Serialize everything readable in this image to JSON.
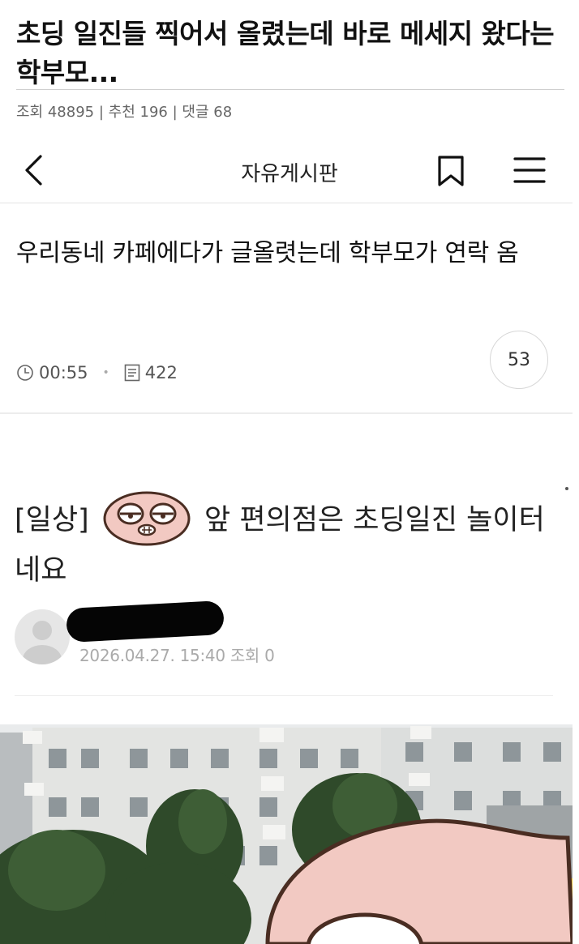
{
  "post": {
    "title": "초딩 일진들 찍어서 올렸는데 바로 메세지 왔다는 학부모...",
    "stats": {
      "views_label": "조회",
      "views": "48895",
      "recommend_label": "추천",
      "recommend": "196",
      "comments_label": "댓글",
      "comments": "68"
    }
  },
  "app_header": {
    "title": "자유게시판",
    "icons": [
      "chevron-left-icon",
      "bookmark-icon",
      "menu-icon"
    ]
  },
  "cafe_post": {
    "title": "우리동네 카페에다가 글올렷는데 학부모가 연락 옴",
    "time": "00:55",
    "views": "422",
    "comment_count": "53"
  },
  "inner_post": {
    "tag": "[일상]",
    "title": "앞 편의점은 초딩일진 놀이터네요",
    "date": "2026.04.27. 15:40",
    "views_label": "조회",
    "views": "0"
  },
  "colors": {
    "text": "#111111",
    "muted": "#666666",
    "emoji_pink": "#f2c9c2",
    "emoji_outline": "#4a2d22"
  }
}
